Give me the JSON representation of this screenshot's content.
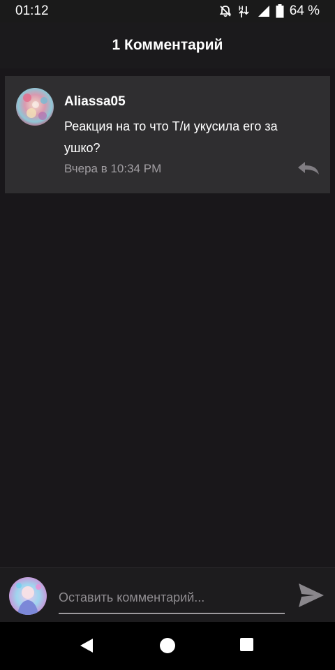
{
  "status_bar": {
    "time": "01:12",
    "battery": "64 %",
    "icons": [
      "notifications-off-icon",
      "data-transfer-icon",
      "signal-icon",
      "battery-icon"
    ]
  },
  "header": {
    "title": "1 Комментарий"
  },
  "comments": [
    {
      "author": "Aliassa05",
      "text": "Реакция на то что Т/и укусила его за ушко?",
      "time": "Вчера в 10:34 PM",
      "avatar_icon": "user-avatar",
      "reply_icon": "reply-icon"
    }
  ],
  "composer": {
    "placeholder": "Оставить комментарий...",
    "value": "",
    "send_icon": "send-icon",
    "avatar_icon": "current-user-avatar"
  },
  "nav": {
    "icons": [
      "back-icon",
      "home-icon",
      "recents-icon"
    ]
  },
  "colors": {
    "background": "#19171a",
    "card": "#2f2e30",
    "muted_text": "#a19ea2"
  }
}
